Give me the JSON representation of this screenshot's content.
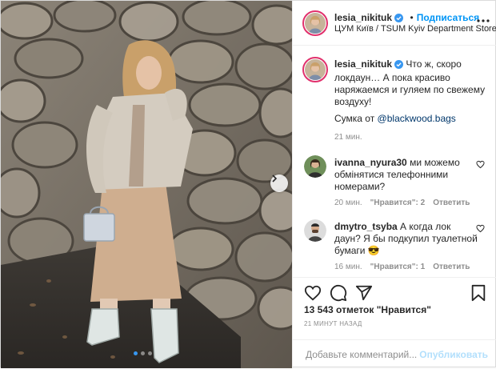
{
  "post": {
    "author": {
      "username": "lesia_nikituk",
      "verified": true
    },
    "header": {
      "follow_label": "Подписаться",
      "separator": "•",
      "location": "ЦУМ Київ / TSUM Kyiv Department Store",
      "more_icon": "more-horizontal-icon"
    },
    "caption": {
      "username": "lesia_nikituk",
      "text": "Что ж, скоро локдаун… А пока красиво наряжаемся и гуляем по свежему воздуху!",
      "bag_prefix": "Сумка от ",
      "bag_mention": "@blackwood.bags",
      "time": "21 мин."
    },
    "comments": [
      {
        "username": "ivanna_nyura30",
        "text": "ми можемо обмінятися телефонними номерами?",
        "time": "20 мин.",
        "likes": "\"Нравится\": 2",
        "reply": "Ответить"
      },
      {
        "username": "dmytro_tsyba",
        "text": "А когда лок даун? Я бы подкупил туалетной бумаги 😎",
        "time": "16 мин.",
        "likes": "\"Нравится\": 1",
        "reply": "Ответить"
      }
    ],
    "likes_text": "13 543 отметок \"Нравится\"",
    "posted_text": "21 минут назад",
    "comment_placeholder": "Добавьте комментарий...",
    "publish_label": "Опубликовать",
    "carousel": {
      "count": 3,
      "active": 0
    },
    "colors": {
      "accent": "#0095f6",
      "publish_disabled": "#b2dffc",
      "text": "#262626",
      "muted": "#8e8e8e",
      "border": "#dbdbdb",
      "carousel_active": "#3897f0"
    },
    "icons": [
      "heart-icon",
      "comment-icon",
      "share-icon",
      "bookmark-icon",
      "verified-icon",
      "chevron-right-icon"
    ]
  }
}
